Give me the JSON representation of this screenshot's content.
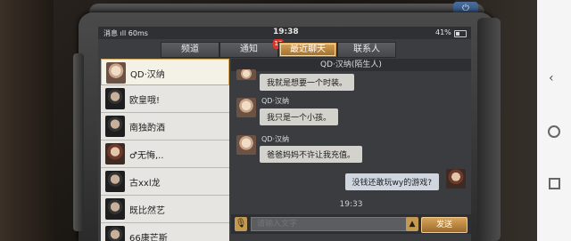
{
  "status_bar": {
    "carrier": "消息",
    "signal": "60ms",
    "time": "19:38",
    "battery": "41%"
  },
  "tabs": [
    {
      "label": "频道"
    },
    {
      "label": "通知",
      "badge": "13"
    },
    {
      "label": "最近聊天",
      "active": true
    },
    {
      "label": "联系人"
    }
  ],
  "contacts": [
    {
      "name": "QD·汉纳",
      "avatar": "female",
      "active": true
    },
    {
      "name": "欧皇哦!",
      "avatar": "male"
    },
    {
      "name": "南独酌酒",
      "avatar": "male"
    },
    {
      "name": "♂无悔,..",
      "avatar": "brown-hair"
    },
    {
      "name": "古xxl龙",
      "avatar": "male"
    },
    {
      "name": "既比然艺",
      "avatar": "male"
    },
    {
      "name": "66康芒斯",
      "avatar": "male"
    }
  ],
  "chat": {
    "header": "QD·汉纳(陌生人)",
    "messages": [
      {
        "sender": "",
        "text": "我就是想要一个时装。",
        "side": "left"
      },
      {
        "sender": "QD·汉纳",
        "text": "我只是一个小孩。",
        "side": "left"
      },
      {
        "sender": "QD·汉纳",
        "text": "爸爸妈妈不许让我充值。",
        "side": "left"
      },
      {
        "sender": "",
        "text": "没钱还敢玩wy的游戏?",
        "side": "right"
      }
    ],
    "timestamp": "19:33"
  },
  "input": {
    "placeholder": "请输入文字",
    "send_label": "发送",
    "mic_icon": "mic-icon",
    "expand_icon": "chevron-up-icon"
  },
  "colors": {
    "accent": "#c49a52",
    "badge": "#e0342a"
  }
}
